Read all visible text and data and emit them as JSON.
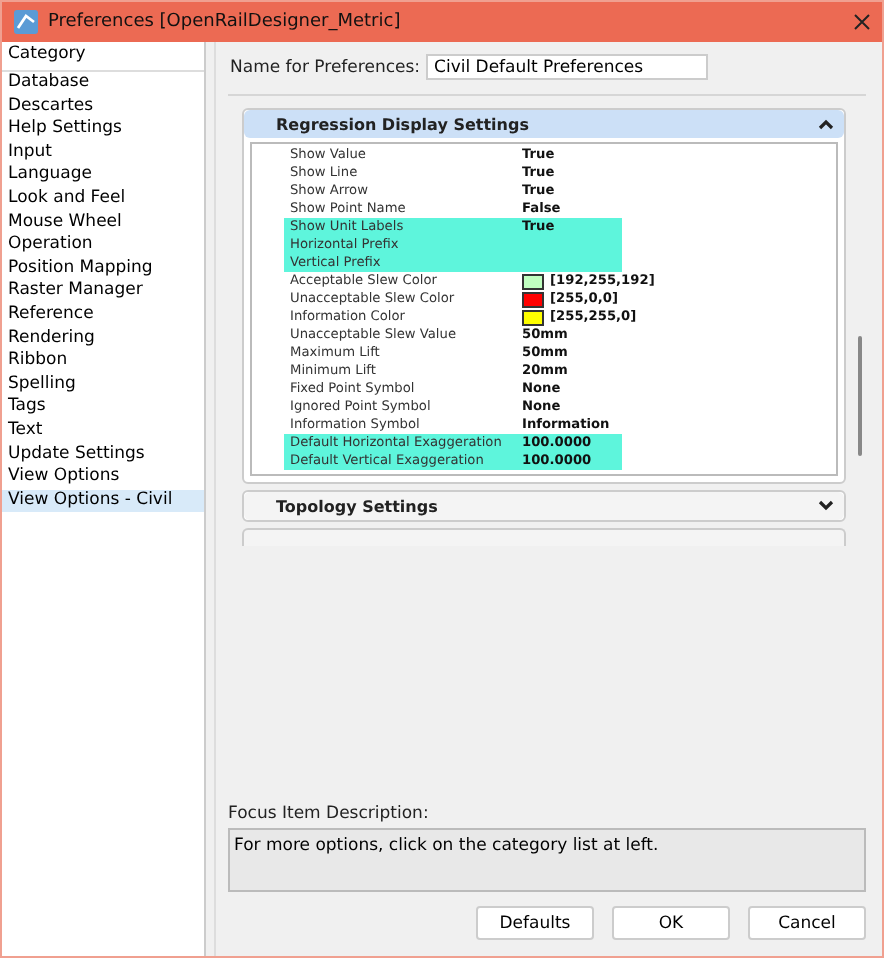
{
  "window": {
    "title": "Preferences [OpenRailDesigner_Metric]"
  },
  "sidebar": {
    "header": "Category",
    "items": [
      {
        "label": "Database",
        "selected": false
      },
      {
        "label": "Descartes",
        "selected": false
      },
      {
        "label": "Help Settings",
        "selected": false
      },
      {
        "label": "Input",
        "selected": false
      },
      {
        "label": "Language",
        "selected": false
      },
      {
        "label": "Look and Feel",
        "selected": false
      },
      {
        "label": "Mouse Wheel",
        "selected": false
      },
      {
        "label": "Operation",
        "selected": false
      },
      {
        "label": "Position Mapping",
        "selected": false
      },
      {
        "label": "Raster Manager",
        "selected": false
      },
      {
        "label": "Reference",
        "selected": false
      },
      {
        "label": "Rendering",
        "selected": false
      },
      {
        "label": "Ribbon",
        "selected": false
      },
      {
        "label": "Spelling",
        "selected": false
      },
      {
        "label": "Tags",
        "selected": false
      },
      {
        "label": "Text",
        "selected": false
      },
      {
        "label": "Update Settings",
        "selected": false
      },
      {
        "label": "View Options",
        "selected": false
      },
      {
        "label": "View Options - Civil",
        "selected": true
      }
    ]
  },
  "name_field": {
    "label": "Name for Preferences:",
    "value": "Civil Default Preferences"
  },
  "sections": [
    {
      "title": "Regression Display Settings",
      "expanded": true,
      "properties": [
        {
          "name": "Show Value",
          "value": "True",
          "highlighted": false
        },
        {
          "name": "Show Line",
          "value": "True",
          "highlighted": false
        },
        {
          "name": "Show Arrow",
          "value": "True",
          "highlighted": false
        },
        {
          "name": "Show Point Name",
          "value": "False",
          "highlighted": false
        },
        {
          "name": "Show Unit Labels",
          "value": "True",
          "highlighted": true
        },
        {
          "name": "Horizontal Prefix",
          "highlighted": true
        },
        {
          "name": "Vertical Prefix",
          "highlighted": true
        },
        {
          "name": "Acceptable Slew Color",
          "value": "[192,255,192]",
          "color": "#c0ffc0",
          "highlighted": false
        },
        {
          "name": "Unacceptable Slew Color",
          "value": "[255,0,0]",
          "color": "#ff0000",
          "highlighted": false
        },
        {
          "name": "Information Color",
          "value": "[255,255,0]",
          "color": "#ffff00",
          "highlighted": false
        },
        {
          "name": "Unacceptable Slew Value",
          "value": "50mm",
          "highlighted": false
        },
        {
          "name": "Maximum Lift",
          "value": "50mm",
          "highlighted": false
        },
        {
          "name": "Minimum Lift",
          "value": "20mm",
          "highlighted": false
        },
        {
          "name": "Fixed Point Symbol",
          "value": "None",
          "highlighted": false
        },
        {
          "name": "Ignored Point Symbol",
          "value": "None",
          "highlighted": false
        },
        {
          "name": "Information Symbol",
          "value": "Information",
          "highlighted": false
        },
        {
          "name": "Default Horizontal Exaggeration",
          "value": "100.0000",
          "highlighted": true
        },
        {
          "name": "Default Vertical Exaggeration",
          "value": "100.0000",
          "highlighted": true
        }
      ]
    },
    {
      "title": "Topology Settings",
      "expanded": false
    }
  ],
  "focus": {
    "label": "Focus Item Description:",
    "text": "For more options, click on the category list at left."
  },
  "buttons": [
    "Defaults",
    "OK",
    "Cancel"
  ]
}
